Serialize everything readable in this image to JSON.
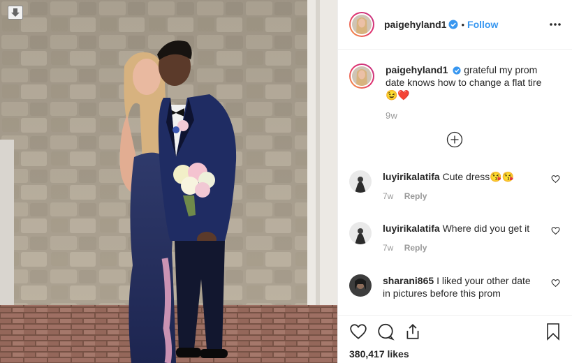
{
  "post": {
    "username": "paigehyland1",
    "verified": true,
    "follow_label": "Follow",
    "separator": "•",
    "caption": "grateful my prom date knows how to change a flat tire",
    "caption_emoji": "😉❤️",
    "caption_time": "9w",
    "likes": "380,417 likes"
  },
  "comments": [
    {
      "username": "luyirikalatifa",
      "text": "Cute dress😘😘",
      "time": "7w",
      "reply_label": "Reply"
    },
    {
      "username": "luyirikalatifa",
      "text": "Where did you get it",
      "time": "7w",
      "reply_label": "Reply"
    },
    {
      "username": "sharani865",
      "text": "I liked your other date in pictures before this prom"
    }
  ],
  "icons": {
    "download": "download-arrow-icon",
    "more": "more-options-icon",
    "verified": "verified-badge-icon",
    "load_more": "add-circle-icon",
    "comment_like": "heart-outline-icon",
    "like": "heart-icon",
    "comment": "comment-bubble-icon",
    "share": "share-icon",
    "save": "bookmark-icon"
  },
  "colors": {
    "accent": "#3897f0",
    "muted": "#999999",
    "text": "#262626",
    "border": "#efefef"
  }
}
